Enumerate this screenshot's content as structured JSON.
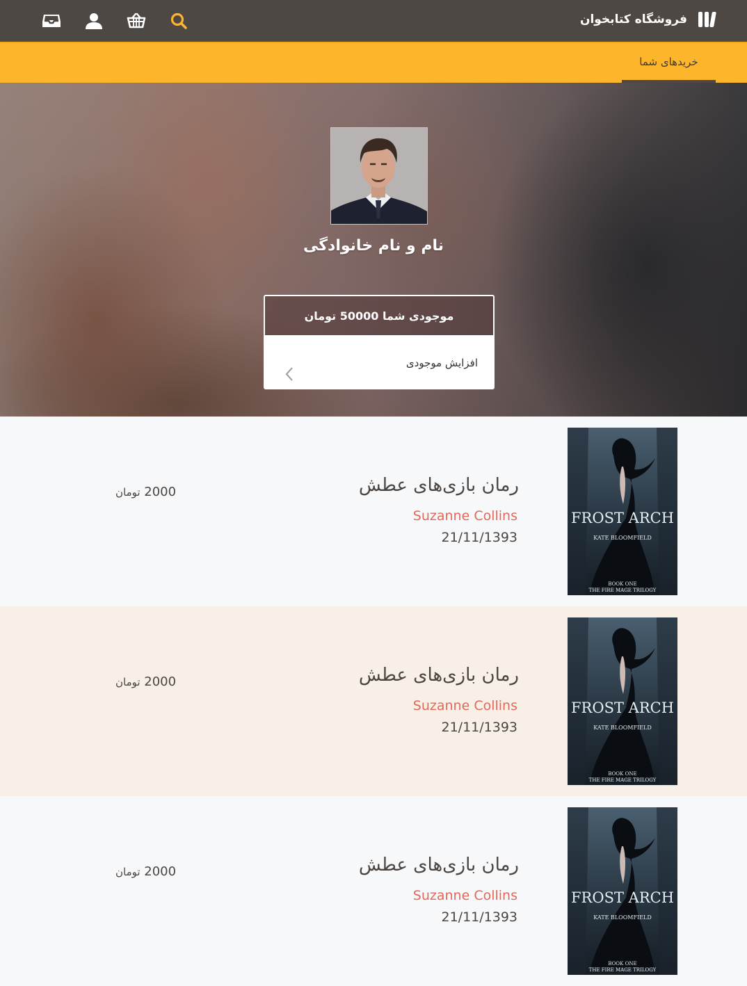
{
  "header": {
    "brand": "فروشگاه کتابخوان",
    "icons": [
      "search-icon",
      "basket-icon",
      "user-icon",
      "inbox-icon"
    ],
    "accent_color": "#fdb52b",
    "bar_color": "#4d4844"
  },
  "tabs": [
    {
      "label": "خریدهای شما",
      "active": true
    }
  ],
  "profile": {
    "name": "نام و نام خانوادگی",
    "balance_label": "موجودی شما 50000 تومان",
    "add_balance_label": "افزایش موجودی"
  },
  "purchases": [
    {
      "title": "رمان بازی‌های عطش",
      "author": "Suzanne Collins",
      "date": "21/11/1393",
      "price": "2000",
      "currency": "تومان",
      "cover": {
        "title": "FROST ARCH",
        "author": "KATE BLOOMFIELD",
        "line1": "BOOK ONE",
        "line2": "THE FIRE MAGE TRILOGY"
      }
    },
    {
      "title": "رمان بازی‌های عطش",
      "author": "Suzanne Collins",
      "date": "21/11/1393",
      "price": "2000",
      "currency": "تومان",
      "cover": {
        "title": "FROST ARCH",
        "author": "KATE BLOOMFIELD",
        "line1": "BOOK ONE",
        "line2": "THE FIRE MAGE TRILOGY"
      }
    },
    {
      "title": "رمان بازی‌های عطش",
      "author": "Suzanne Collins",
      "date": "21/11/1393",
      "price": "2000",
      "currency": "تومان",
      "cover": {
        "title": "FROST ARCH",
        "author": "KATE BLOOMFIELD",
        "line1": "BOOK ONE",
        "line2": "THE FIRE MAGE TRILOGY"
      }
    }
  ]
}
